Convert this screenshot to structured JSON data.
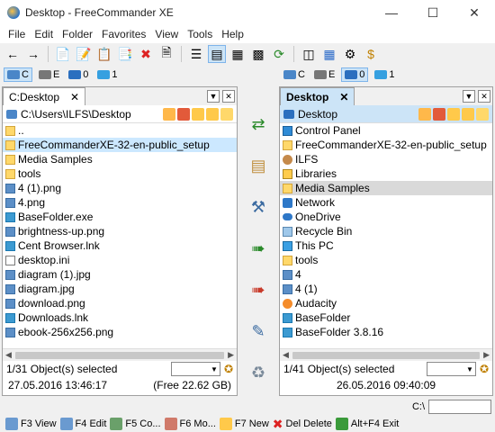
{
  "window": {
    "title": "Desktop - FreeCommander XE"
  },
  "menu": [
    "File",
    "Edit",
    "Folder",
    "Favorites",
    "View",
    "Tools",
    "Help"
  ],
  "left": {
    "drives": [
      {
        "label": "C",
        "selected": true
      },
      {
        "label": "E",
        "selected": false
      },
      {
        "label": "0",
        "selected": false
      },
      {
        "label": "1",
        "selected": false
      }
    ],
    "tab": "C:Desktop",
    "path": "C:\\Users\\ILFS\\Desktop",
    "files": [
      {
        "name": "..",
        "icon": "folder"
      },
      {
        "name": "FreeCommanderXE-32-en-public_setup",
        "icon": "folder",
        "selected": true
      },
      {
        "name": "Media Samples",
        "icon": "folder"
      },
      {
        "name": "tools",
        "icon": "folder"
      },
      {
        "name": "4 (1).png",
        "icon": "file"
      },
      {
        "name": "4.png",
        "icon": "file"
      },
      {
        "name": "BaseFolder.exe",
        "icon": "exe"
      },
      {
        "name": "brightness-up.png",
        "icon": "file"
      },
      {
        "name": "Cent Browser.lnk",
        "icon": "exe"
      },
      {
        "name": "desktop.ini",
        "icon": "ini"
      },
      {
        "name": "diagram (1).jpg",
        "icon": "file"
      },
      {
        "name": "diagram.jpg",
        "icon": "file"
      },
      {
        "name": "download.png",
        "icon": "file"
      },
      {
        "name": "Downloads.lnk",
        "icon": "exe"
      },
      {
        "name": "ebook-256x256.png",
        "icon": "file"
      }
    ],
    "status": "1/31 Object(s) selected",
    "date": "27.05.2016 13:46:17",
    "free": "(Free 22.62 GB)"
  },
  "right": {
    "drives": [
      {
        "label": "C",
        "selected": false
      },
      {
        "label": "E",
        "selected": false
      },
      {
        "label": "0",
        "selected": true
      },
      {
        "label": "1",
        "selected": false
      }
    ],
    "tab": "Desktop",
    "path": "Desktop",
    "files": [
      {
        "name": "Control Panel",
        "icon": "cp"
      },
      {
        "name": "FreeCommanderXE-32-en-public_setup",
        "icon": "folder"
      },
      {
        "name": "ILFS",
        "icon": "user"
      },
      {
        "name": "Libraries",
        "icon": "lib"
      },
      {
        "name": "Media Samples",
        "icon": "folder",
        "selected": true
      },
      {
        "name": "Network",
        "icon": "net"
      },
      {
        "name": "OneDrive",
        "icon": "cloud"
      },
      {
        "name": "Recycle Bin",
        "icon": "bin"
      },
      {
        "name": "This PC",
        "icon": "pc"
      },
      {
        "name": "tools",
        "icon": "folder"
      },
      {
        "name": "4",
        "icon": "file"
      },
      {
        "name": "4 (1)",
        "icon": "file"
      },
      {
        "name": "Audacity",
        "icon": "aud"
      },
      {
        "name": "BaseFolder",
        "icon": "exe"
      },
      {
        "name": "BaseFolder 3.8.16",
        "icon": "exe"
      }
    ],
    "status": "1/41 Object(s) selected",
    "date": "26.05.2016 09:40:09"
  },
  "cmd": {
    "prefix": "C:\\"
  },
  "fkeys": [
    {
      "label": "F3 View",
      "icon": "view-icon"
    },
    {
      "label": "F4 Edit",
      "icon": "edit-icon"
    },
    {
      "label": "F5 Co...",
      "icon": "copy-icon"
    },
    {
      "label": "F6 Mo...",
      "icon": "move-icon"
    },
    {
      "label": "F7 New",
      "icon": "new-folder-icon"
    },
    {
      "label": "Del Delete",
      "icon": "delete-icon"
    },
    {
      "label": "Alt+F4 Exit",
      "icon": "exit-icon"
    }
  ]
}
